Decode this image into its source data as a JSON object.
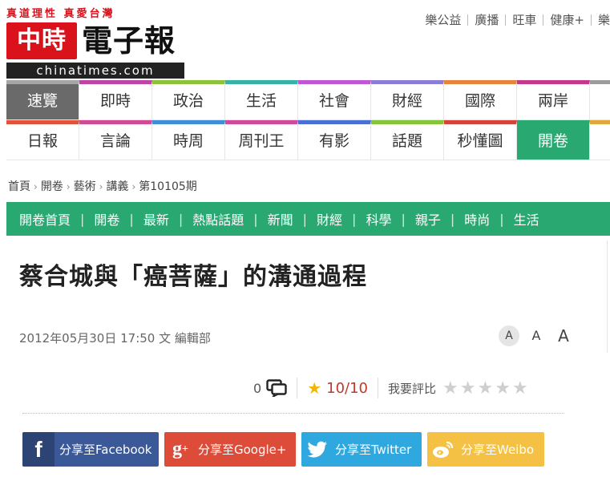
{
  "header": {
    "slogan": "真道理性 真愛台灣",
    "logo_mark": "中時",
    "logo_text": "電子報",
    "domain": "chinatimes.com",
    "top_links": [
      "樂公益",
      "廣播",
      "旺車",
      "健康+",
      "樂"
    ]
  },
  "nav": {
    "row1": [
      {
        "label": "速覽",
        "color": "#a6a6a6"
      },
      {
        "label": "即時",
        "color": "#c044a7"
      },
      {
        "label": "政治",
        "color": "#8bc33c"
      },
      {
        "label": "生活",
        "color": "#36b3a6"
      },
      {
        "label": "社會",
        "color": "#bf57d6"
      },
      {
        "label": "財經",
        "color": "#8d7dd7"
      },
      {
        "label": "國際",
        "color": "#e8843a"
      },
      {
        "label": "兩岸",
        "color": "#c6368b"
      },
      {
        "label": "",
        "color": "#9b9b9b"
      }
    ],
    "row2": [
      {
        "label": "日報",
        "color": "#e0533a"
      },
      {
        "label": "言論",
        "color": "#d04a96"
      },
      {
        "label": "時周",
        "color": "#3f8ed8"
      },
      {
        "label": "周刊王",
        "color": "#d04a9c"
      },
      {
        "label": "有影",
        "color": "#4a70d6"
      },
      {
        "label": "話題",
        "color": "#86c43c"
      },
      {
        "label": "秒懂圖",
        "color": "#d4443a"
      },
      {
        "label": "開卷",
        "color": "#2aa872"
      },
      {
        "label": "",
        "color": "#e2a73b"
      }
    ]
  },
  "breadcrumb": [
    "首頁",
    "開卷",
    "藝術",
    "講義",
    "第10105期"
  ],
  "subnav": [
    "開卷首頁",
    "開卷",
    "最新",
    "熱點話題",
    "新聞",
    "財經",
    "科學",
    "親子",
    "時尚",
    "生活"
  ],
  "article": {
    "title": "蔡合城與「癌菩薩」的溝通過程",
    "meta": "2012年05月30日 17:50 文 編輯部",
    "font_sizes": [
      "A",
      "A",
      "A"
    ]
  },
  "rating": {
    "comments": "0",
    "score": "10/10",
    "rate_label": "我要評比",
    "stars": 5
  },
  "share": {
    "facebook": "分享至Facebook",
    "google": "分享至Google+",
    "twitter": "分享至Twitter",
    "weibo": "分享至Weibo"
  },
  "colors": {
    "brand_red": "#d9121c",
    "green": "#2aa872"
  }
}
